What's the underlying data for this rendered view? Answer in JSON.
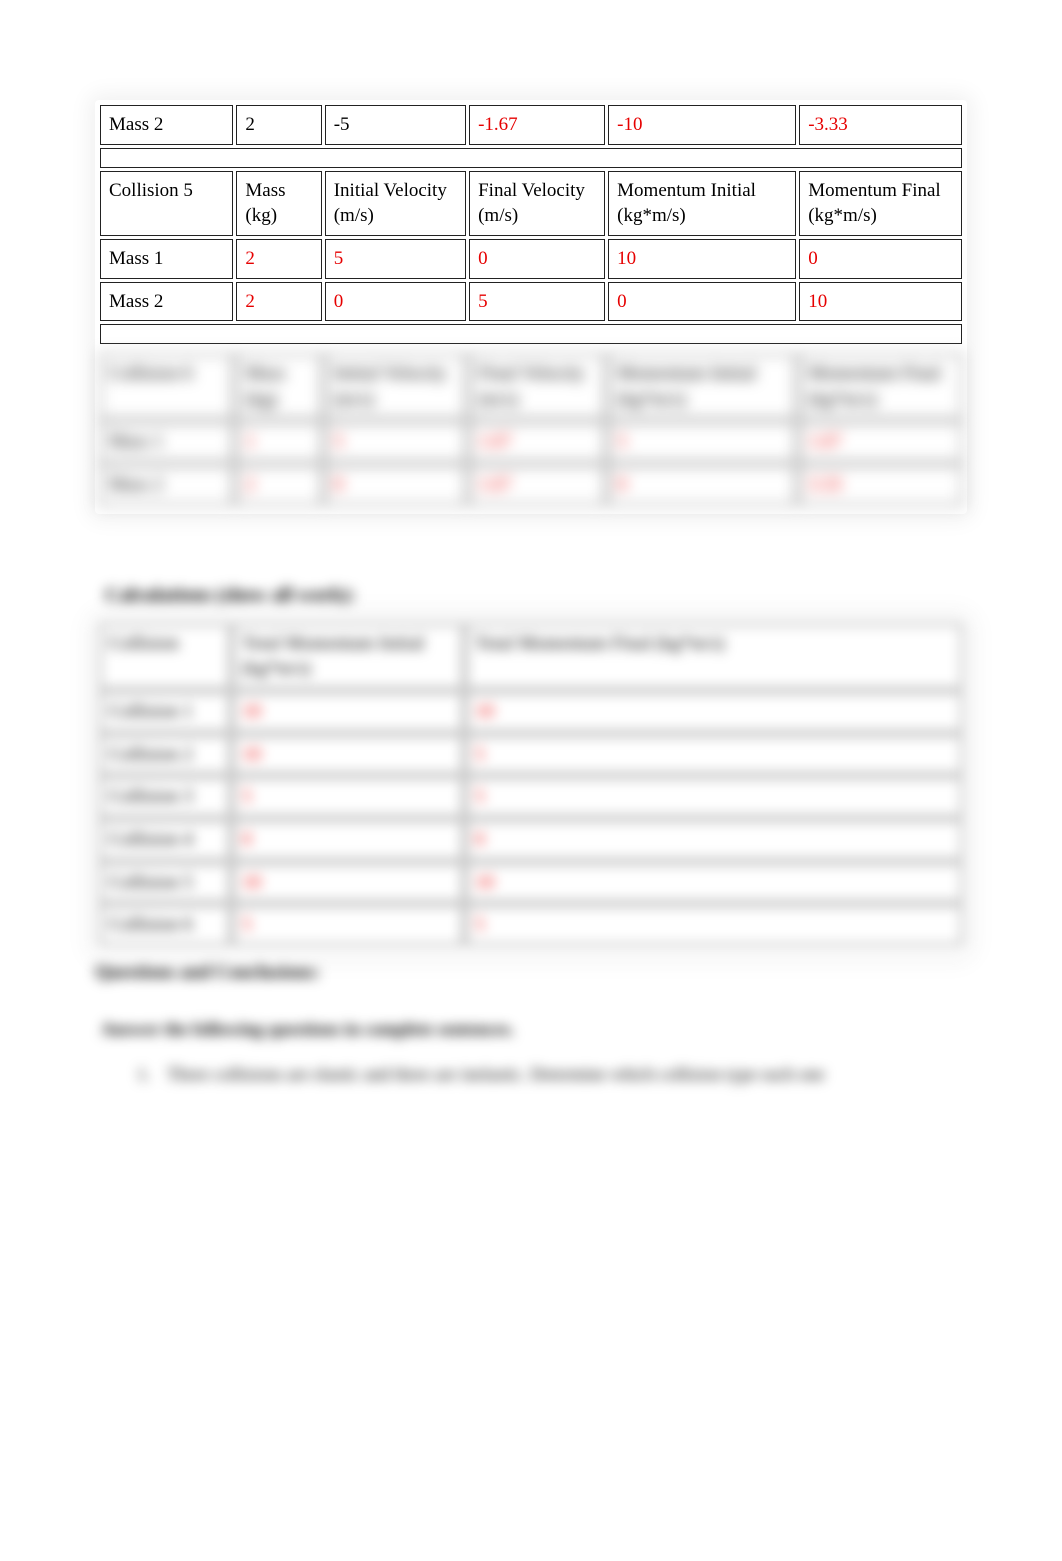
{
  "top_row": {
    "label": "Mass 2",
    "mass": "2",
    "vi": "-5",
    "vf": "-1.67",
    "pi": "-10",
    "pf": "-3.33"
  },
  "collision5_header": {
    "title": "Collision 5",
    "mass": "Mass (kg)",
    "vi": "Initial Velocity (m/s)",
    "vf": "Final Velocity (m/s)",
    "pi": "Momentum Initial (kg*m/s)",
    "pf": "Momentum Final (kg*m/s)"
  },
  "collision5_rows": [
    {
      "label": "Mass 1",
      "mass": "2",
      "vi": "5",
      "vf": "0",
      "pi": "10",
      "pf": "0"
    },
    {
      "label": "Mass 2",
      "mass": "2",
      "vi": "0",
      "vf": "5",
      "pi": "0",
      "pf": "10"
    }
  ],
  "collision6_header": {
    "title": "Collision 6",
    "mass": "Mass (kg)",
    "vi": "Initial Velocity (m/s)",
    "vf": "Final Velocity (m/s)",
    "pi": "Momentum Initial (kg*m/s)",
    "pf": "Momentum Final (kg*m/s)"
  },
  "collision6_rows": [
    {
      "label": "Mass 1",
      "mass": "1",
      "vi": "5",
      "vf": "1.67",
      "pi": "5",
      "pf": "1.67"
    },
    {
      "label": "Mass 2",
      "mass": "2",
      "vi": "0",
      "vf": "1.67",
      "pi": "0",
      "pf": "3.33"
    }
  ],
  "calc_heading": "Calculations (show all work):",
  "calc_header": {
    "c": "Collision",
    "ti": "Total Momentum Initial (kg*m/s)",
    "tf": "Total Momentum Final (kg*m/s)"
  },
  "calc_rows": [
    {
      "c": "Collision 1",
      "ti": "10",
      "tf": "10"
    },
    {
      "c": "Collision 2",
      "ti": "10",
      "tf": "5"
    },
    {
      "c": "Collision 3",
      "ti": "5",
      "tf": "5"
    },
    {
      "c": "Collision 4",
      "ti": "0",
      "tf": "0"
    },
    {
      "c": "Collision 5",
      "ti": "10",
      "tf": "10"
    },
    {
      "c": "Collision 6",
      "ti": "5",
      "tf": "5"
    }
  ],
  "qna_heading": "Questions and Conclusions:",
  "answer_prompt": "Answer the following questions in complete sentences.",
  "question1": "Three collisions are elastic and three are inelastic. Determine which collision type each one"
}
